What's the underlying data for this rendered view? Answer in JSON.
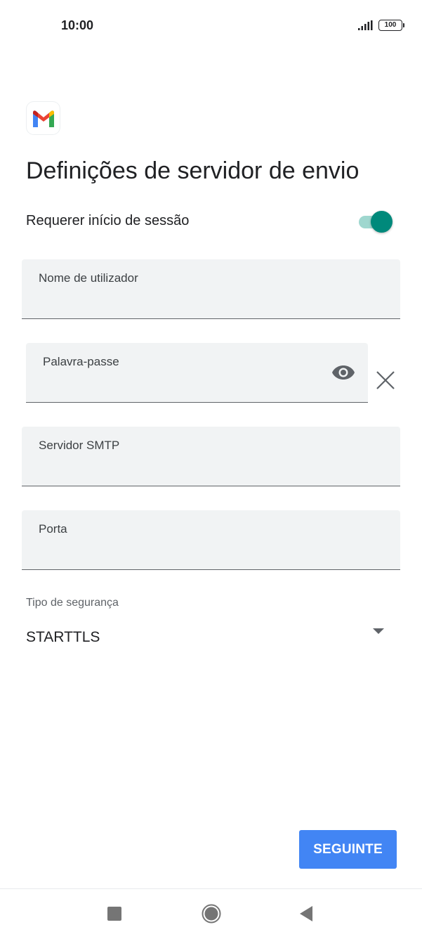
{
  "status_bar": {
    "time": "10:00",
    "battery": "100",
    "icons": [
      "signal-icon",
      "battery-icon"
    ]
  },
  "app": {
    "logo_icon": "gmail-logo-icon"
  },
  "page": {
    "title": "Definições de servidor de envio"
  },
  "login_toggle": {
    "label": "Requerer início de sessão",
    "enabled": true,
    "accent_color": "#00897b"
  },
  "fields": {
    "username": {
      "label": "Nome de utilizador",
      "value": ""
    },
    "password": {
      "label": "Palavra-passe",
      "value": "",
      "icons": [
        "eye-icon",
        "close-icon"
      ]
    },
    "smtp_server": {
      "label": "Servidor SMTP",
      "value": ""
    },
    "port": {
      "label": "Porta",
      "value": ""
    }
  },
  "security": {
    "label": "Tipo de segurança",
    "selected": "STARTTLS",
    "icon": "dropdown-arrow-icon"
  },
  "actions": {
    "next_label": "SEGUINTE",
    "button_color": "#4285f4"
  },
  "nav_bar": {
    "icons": [
      "recents-icon",
      "home-icon",
      "back-icon"
    ]
  }
}
